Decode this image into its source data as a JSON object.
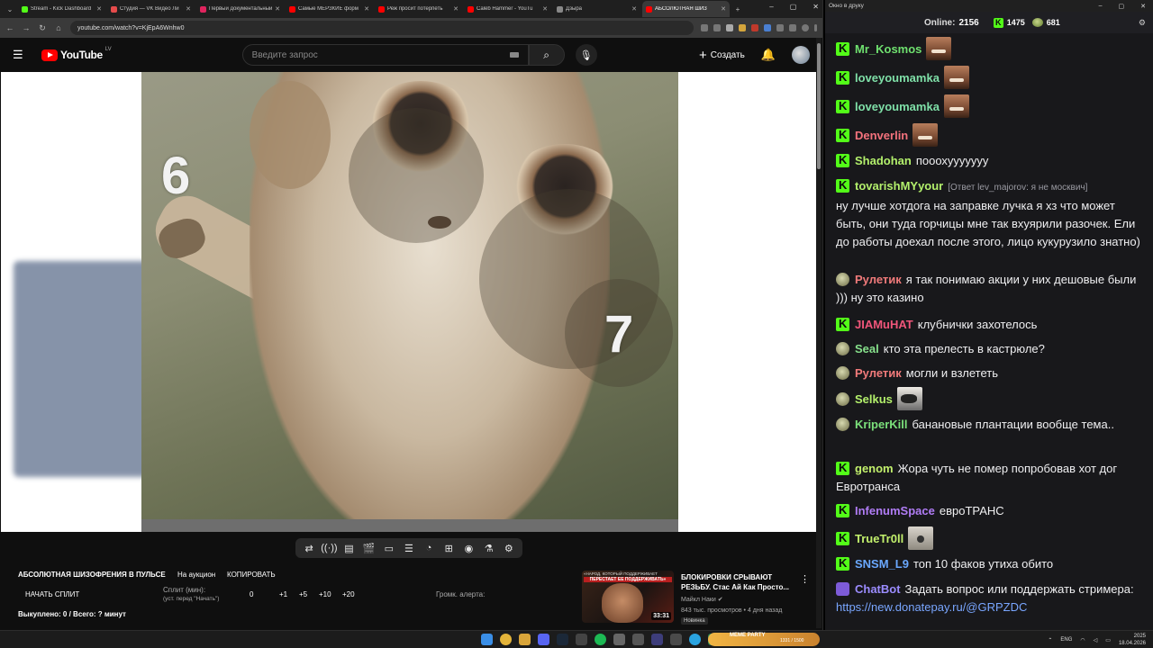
{
  "browser": {
    "tabs": [
      {
        "label": "Stream - Kick Dashboard",
        "color": "#53fc18"
      },
      {
        "label": "Студия — VK Видео Ли",
        "color": "#e54b4b"
      },
      {
        "label": "Первый документальный",
        "color": "#e0245e"
      },
      {
        "label": "Самые МЕРЗКИЕ форм",
        "color": "#ff0000"
      },
      {
        "label": "Реж просит потерпеть",
        "color": "#ff0000"
      },
      {
        "label": "Caleb Hammer - YouTu",
        "color": "#ff0000"
      },
      {
        "label": "Дзыра",
        "color": "#888888"
      },
      {
        "label": "АБСОЛЮТНАЯ ШИЗ",
        "color": "#ff0000",
        "active": true
      }
    ],
    "url": "youtube.com/watch?v=KjEpA6Wnhw0"
  },
  "youtube": {
    "logo_text": "YouTube",
    "region": "LV",
    "search_placeholder": "Введите запрос",
    "create_label": "Создать"
  },
  "video": {
    "overlay_numbers": [
      "6",
      "7"
    ]
  },
  "player_controls": [
    "loop-icon",
    "broadcast-icon",
    "queue-icon",
    "clapper-icon",
    "picture-icon",
    "list-icon",
    "speed-icon",
    "plus-icon",
    "camera-icon",
    "flask-icon",
    "gear-icon"
  ],
  "stream_tool": {
    "title": "АБСОЛЮТНАЯ ШИЗОФРЕНИЯ В ПУЛЬСЕ",
    "auction_label": "На аукцион",
    "copy_label": "КОПИРОВАТЬ",
    "start_split": "НАЧАТЬ СПЛИТ",
    "split_label": "Сплит (мин):",
    "split_hint": "(уст. перед \"Начать\")",
    "split_value": "0",
    "steps": [
      "+1",
      "+5",
      "+10",
      "+20"
    ],
    "alert_volume_label": "Громк. алерта:",
    "bought_label": "Выкуплено: 0 / Всего: ? минут"
  },
  "recommended": {
    "thumb_top": "«НАРОД, КОТОРЫЙ ПОДДЕРЖИВАЕТ ВЛАСТЬ,",
    "thumb_red": "ПЕРЕСТАЕТ ЕЕ ПОДДЕРЖИВАТЬ»",
    "duration": "33:31",
    "title": "БЛОКИРОВКИ СРЫВАЮТ РЕЗЬБУ. Стас Ай Как Просто...",
    "channel": "Майкл Наки",
    "meta": "843 тыс. просмотров • 4 дня назад",
    "badge": "Новинка"
  },
  "chat": {
    "window_title": "Окно в друку",
    "online_label": "Online:",
    "online_value": "2156",
    "kick_count": "1475",
    "pepe_count": "681",
    "messages": [
      {
        "platform": "kick",
        "nick": "Mr_Kosmos",
        "color": "#6fe16f",
        "text": "",
        "emote": "face"
      },
      {
        "platform": "kick",
        "nick": "loveyoumamka",
        "color": "#7fe0a8",
        "text": "",
        "emote": "face"
      },
      {
        "platform": "kick",
        "nick": "loveyoumamka",
        "color": "#7fe0a8",
        "text": "",
        "emote": "face"
      },
      {
        "platform": "kick",
        "nick": "Denverlin",
        "color": "#f4727d",
        "text": "",
        "emote": "face"
      },
      {
        "platform": "kick",
        "nick": "Shadohan",
        "color": "#b3f06c",
        "text": "пооохууууууу"
      },
      {
        "platform": "kick",
        "nick": "tovarishMYyour",
        "color": "#b3f06c",
        "reply": "[Ответ lev_majorov: я не москвич]",
        "text": "ну лучше хотдога на заправке лучка я хз что может быть, они туда горчицы мне так вхуярили разочек. Ели до работы доехал после этого, лицо кукурузило знатно)"
      },
      {
        "platform": "pepe",
        "nick": "Рулетик",
        "color": "#f07a7a",
        "text": "я так понимаю акции у них дешовые были ))) ну это казино"
      },
      {
        "platform": "kick",
        "nick": "JIAMuHAT",
        "color": "#f0557a",
        "text": "клубнички захотелось"
      },
      {
        "platform": "pepe",
        "nick": "Seal",
        "color": "#86e08b",
        "text": "кто эта прелесть в кастрюле?"
      },
      {
        "platform": "pepe",
        "nick": "Рулетик",
        "color": "#f07a7a",
        "text": "могли и взлететь"
      },
      {
        "platform": "pepe",
        "nick": "Selkus",
        "color": "#b3f06c",
        "text": "",
        "emote": "dog"
      },
      {
        "platform": "pepe",
        "nick": "KriperKill",
        "color": "#7be07b",
        "text": "банановые плантации вообще тема.."
      },
      {
        "platform": "kick",
        "nick": "genom",
        "color": "#c2f06c",
        "text": "Жора чуть не помер попробовав хот дог Евротранса"
      },
      {
        "platform": "kick",
        "nick": "InfenumSpace",
        "color": "#b07cf5",
        "text": "евроТРАНС"
      },
      {
        "platform": "kick",
        "nick": "TrueTr0ll",
        "color": "#c2f06c",
        "text": "",
        "emote": "cat"
      },
      {
        "platform": "kick",
        "nick": "SNSM_L9",
        "color": "#6aa8ff",
        "text": "топ 10 факов утиха обито"
      },
      {
        "platform": "bot",
        "nick": "ChatBot",
        "color": "#9b8cff",
        "text": "Задать вопрос или поддержать стримера:",
        "link": "https://new.donatepay.ru/@GRPZDC"
      }
    ]
  },
  "taskbar": {
    "meme_text": "MEME PARTY",
    "meme_count": "1331 / 1500",
    "lang": "ENG",
    "time": "2025",
    "date": "18.04.2026"
  }
}
